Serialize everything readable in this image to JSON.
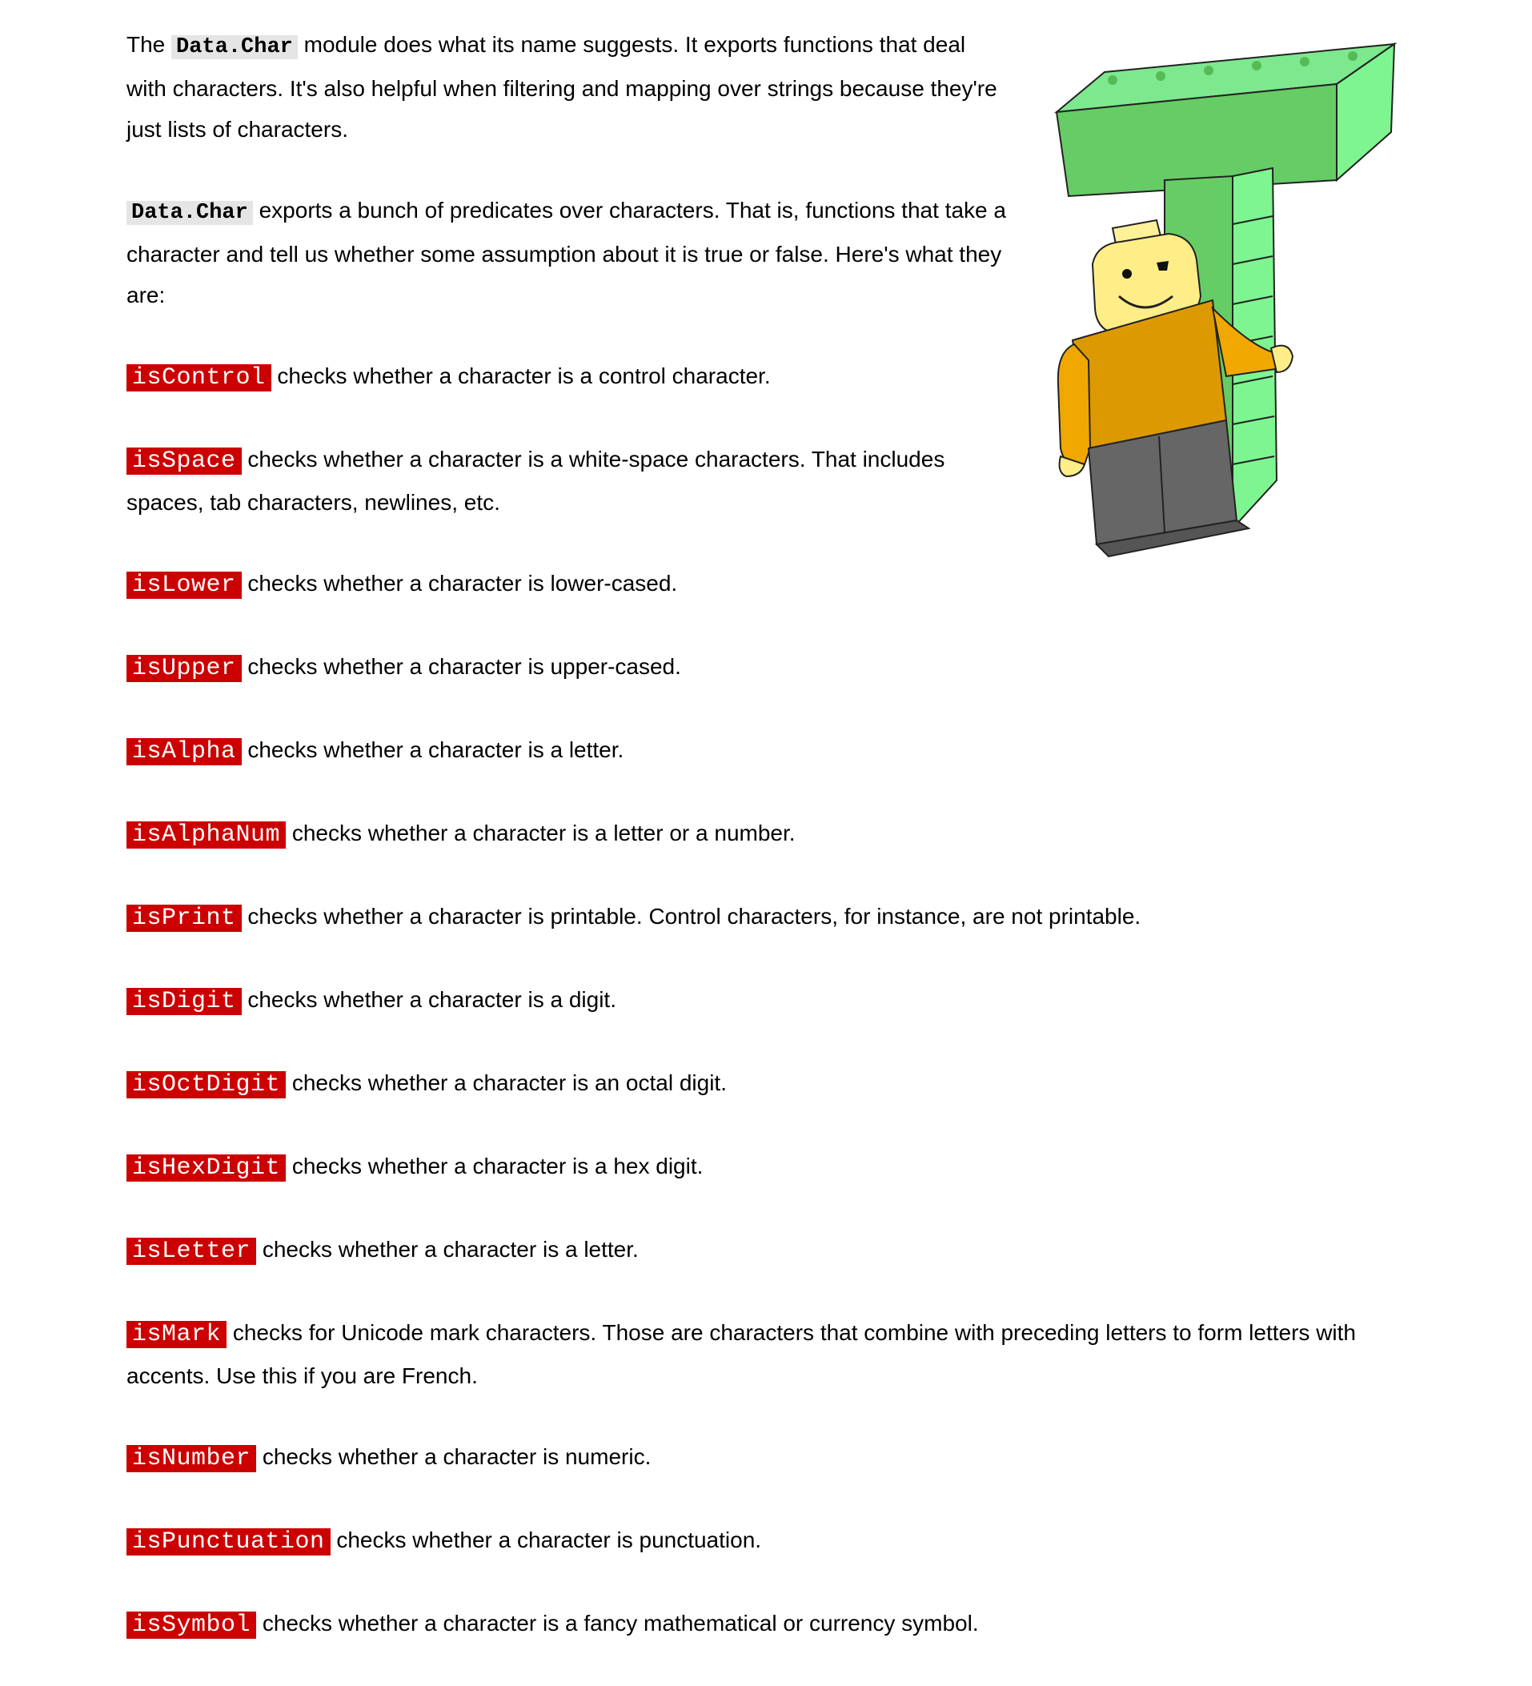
{
  "intro": {
    "p1_before": "The",
    "p1_code": "Data.Char",
    "p1_after": "module does what its name suggests. It exports functions that deal with characters. It's also helpful when filtering and mapping over strings because they're just lists of characters.",
    "p2_code": "Data.Char",
    "p2_after": "exports a bunch of predicates over characters. That is, functions that take a character and tell us whether some assumption about it is true or false. Here's what they are:"
  },
  "predicates": [
    {
      "name": "isControl",
      "desc": "checks whether a character is a control character."
    },
    {
      "name": "isSpace",
      "desc": "checks whether a character is a white-space characters. That includes spaces, tab characters, newlines, etc."
    },
    {
      "name": "isLower",
      "desc": "checks whether a character is lower-cased."
    },
    {
      "name": "isUpper",
      "desc": "checks whether a character is upper-cased."
    },
    {
      "name": "isAlpha",
      "desc": "checks whether a character is a letter."
    },
    {
      "name": "isAlphaNum",
      "desc": "checks whether a character is a letter or a number."
    },
    {
      "name": "isPrint",
      "desc": "checks whether a character is printable. Control characters, for instance, are not printable."
    },
    {
      "name": "isDigit",
      "desc": "checks whether a character is a digit."
    },
    {
      "name": "isOctDigit",
      "desc": "checks whether a character is an octal digit."
    },
    {
      "name": "isHexDigit",
      "desc": "checks whether a character is a hex digit."
    },
    {
      "name": "isLetter",
      "desc": "checks whether a character is a letter."
    },
    {
      "name": "isMark",
      "desc": "checks for Unicode mark characters. Those are characters that combine with preceding letters to form letters with accents. Use this if you are French."
    },
    {
      "name": "isNumber",
      "desc": "checks whether a character is numeric."
    },
    {
      "name": "isPunctuation",
      "desc": "checks whether a character is punctuation."
    },
    {
      "name": "isSymbol",
      "desc": "checks whether a character is a fancy mathematical or currency symbol."
    }
  ],
  "colors": {
    "code_red_bg": "#cc0000",
    "code_gray_bg": "#e5e5e5",
    "block_green": "#66cc66",
    "figure_yellow": "#ffee88",
    "shirt_orange": "#dd9900",
    "pants_gray": "#666666"
  },
  "icons": {
    "illustration": "lego-figure-leaning-on-letter-t-illustration"
  }
}
